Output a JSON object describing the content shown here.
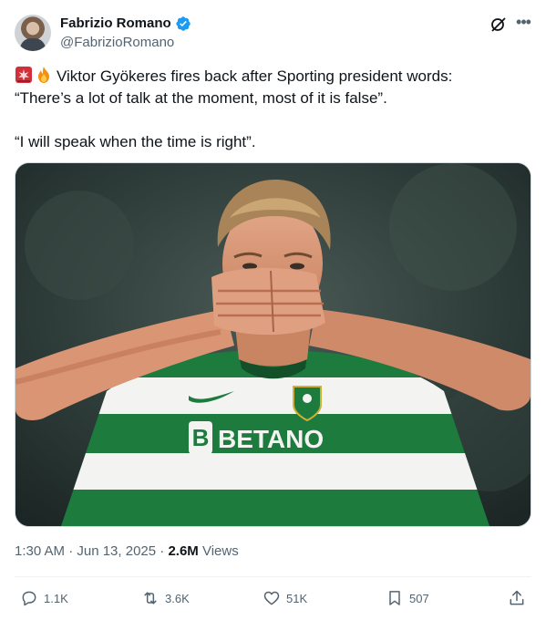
{
  "author": {
    "display_name": "Fabrizio Romano",
    "handle": "@FabrizioRomano",
    "verified": true
  },
  "tweet": {
    "line1": "Viktor Gyökeres fires back after Sporting president words:",
    "line2": "“There’s a lot of talk at the moment, most of it is false”.",
    "line3": "“I will speak when the time is right”.",
    "emojis": [
      "siren-emoji",
      "fire-emoji"
    ]
  },
  "media": {
    "sponsor_text": "BETANO",
    "sponsor_letter": "B"
  },
  "meta": {
    "timestamp": "1:30 AM · Jun 13, 2025 · ",
    "views_count": "2.6M",
    "views_label": " Views"
  },
  "actions": {
    "replies": "1.1K",
    "reposts": "3.6K",
    "likes": "51K",
    "bookmarks": "507"
  },
  "colors": {
    "text": "#0f1419",
    "secondary": "#536471",
    "verified": "#1d9bf0",
    "jersey_green": "#1f7a3c"
  }
}
